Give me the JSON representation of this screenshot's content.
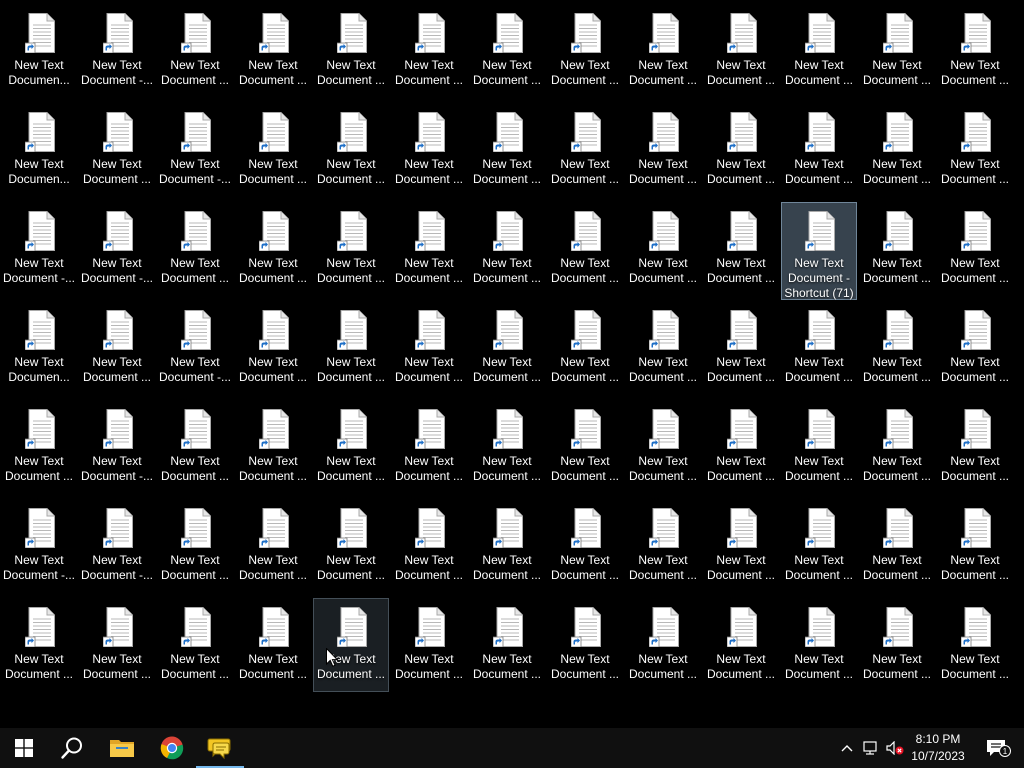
{
  "desktop": {
    "icons": [
      {
        "label1": "New Text",
        "label2": "Documen..."
      },
      {
        "label1": "New Text",
        "label2": "Document -..."
      },
      {
        "label1": "New Text",
        "label2": "Document ..."
      },
      {
        "label1": "New Text",
        "label2": "Document ..."
      },
      {
        "label1": "New Text",
        "label2": "Document ..."
      },
      {
        "label1": "New Text",
        "label2": "Document ..."
      },
      {
        "label1": "New Text",
        "label2": "Document ..."
      },
      {
        "label1": "New Text",
        "label2": "Document ..."
      },
      {
        "label1": "New Text",
        "label2": "Document ..."
      },
      {
        "label1": "New Text",
        "label2": "Document ..."
      },
      {
        "label1": "New Text",
        "label2": "Document ..."
      },
      {
        "label1": "New Text",
        "label2": "Document ..."
      },
      {
        "label1": "New Text",
        "label2": "Document ..."
      },
      {
        "label1": "New Text",
        "label2": "Documen..."
      },
      {
        "label1": "New Text",
        "label2": "Document ..."
      },
      {
        "label1": "New Text",
        "label2": "Document -..."
      },
      {
        "label1": "New Text",
        "label2": "Document ..."
      },
      {
        "label1": "New Text",
        "label2": "Document ..."
      },
      {
        "label1": "New Text",
        "label2": "Document ..."
      },
      {
        "label1": "New Text",
        "label2": "Document ..."
      },
      {
        "label1": "New Text",
        "label2": "Document ..."
      },
      {
        "label1": "New Text",
        "label2": "Document ..."
      },
      {
        "label1": "New Text",
        "label2": "Document ..."
      },
      {
        "label1": "New Text",
        "label2": "Document ..."
      },
      {
        "label1": "New Text",
        "label2": "Document ..."
      },
      {
        "label1": "New Text",
        "label2": "Document ..."
      },
      {
        "label1": "New Text",
        "label2": "Document -..."
      },
      {
        "label1": "New Text",
        "label2": "Document -..."
      },
      {
        "label1": "New Text",
        "label2": "Document ..."
      },
      {
        "label1": "New Text",
        "label2": "Document ..."
      },
      {
        "label1": "New Text",
        "label2": "Document ..."
      },
      {
        "label1": "New Text",
        "label2": "Document ..."
      },
      {
        "label1": "New Text",
        "label2": "Document ..."
      },
      {
        "label1": "New Text",
        "label2": "Document ..."
      },
      {
        "label1": "New Text",
        "label2": "Document ..."
      },
      {
        "label1": "New Text",
        "label2": "Document ..."
      },
      {
        "label1": "New Text",
        "label2": "Document -",
        "label3": "Shortcut (71)",
        "selected": true
      },
      {
        "label1": "New Text",
        "label2": "Document ..."
      },
      {
        "label1": "New Text",
        "label2": "Document ..."
      },
      {
        "label1": "New Text",
        "label2": "Documen..."
      },
      {
        "label1": "New Text",
        "label2": "Document ..."
      },
      {
        "label1": "New Text",
        "label2": "Document -..."
      },
      {
        "label1": "New Text",
        "label2": "Document ..."
      },
      {
        "label1": "New Text",
        "label2": "Document ..."
      },
      {
        "label1": "New Text",
        "label2": "Document ..."
      },
      {
        "label1": "New Text",
        "label2": "Document ..."
      },
      {
        "label1": "New Text",
        "label2": "Document ..."
      },
      {
        "label1": "New Text",
        "label2": "Document ..."
      },
      {
        "label1": "New Text",
        "label2": "Document ..."
      },
      {
        "label1": "New Text",
        "label2": "Document ..."
      },
      {
        "label1": "New Text",
        "label2": "Document ..."
      },
      {
        "label1": "New Text",
        "label2": "Document ..."
      },
      {
        "label1": "New Text",
        "label2": "Document ..."
      },
      {
        "label1": "New Text",
        "label2": "Document -..."
      },
      {
        "label1": "New Text",
        "label2": "Document ..."
      },
      {
        "label1": "New Text",
        "label2": "Document ..."
      },
      {
        "label1": "New Text",
        "label2": "Document ..."
      },
      {
        "label1": "New Text",
        "label2": "Document ..."
      },
      {
        "label1": "New Text",
        "label2": "Document ..."
      },
      {
        "label1": "New Text",
        "label2": "Document ..."
      },
      {
        "label1": "New Text",
        "label2": "Document ..."
      },
      {
        "label1": "New Text",
        "label2": "Document ..."
      },
      {
        "label1": "New Text",
        "label2": "Document ..."
      },
      {
        "label1": "New Text",
        "label2": "Document ..."
      },
      {
        "label1": "New Text",
        "label2": "Document ..."
      },
      {
        "label1": "New Text",
        "label2": "Document -..."
      },
      {
        "label1": "New Text",
        "label2": "Document -..."
      },
      {
        "label1": "New Text",
        "label2": "Document ..."
      },
      {
        "label1": "New Text",
        "label2": "Document ..."
      },
      {
        "label1": "New Text",
        "label2": "Document ..."
      },
      {
        "label1": "New Text",
        "label2": "Document ..."
      },
      {
        "label1": "New Text",
        "label2": "Document ..."
      },
      {
        "label1": "New Text",
        "label2": "Document ..."
      },
      {
        "label1": "New Text",
        "label2": "Document ..."
      },
      {
        "label1": "New Text",
        "label2": "Document ..."
      },
      {
        "label1": "New Text",
        "label2": "Document ..."
      },
      {
        "label1": "New Text",
        "label2": "Document ..."
      },
      {
        "label1": "New Text",
        "label2": "Document ..."
      },
      {
        "label1": "New Text",
        "label2": "Document ..."
      },
      {
        "label1": "New Text",
        "label2": "Document ..."
      },
      {
        "label1": "New Text",
        "label2": "Document ..."
      },
      {
        "label1": "New Text",
        "label2": "Document ..."
      },
      {
        "label1": "New Text",
        "label2": "Document ...",
        "hovered": true
      },
      {
        "label1": "New Text",
        "label2": "Document ..."
      },
      {
        "label1": "New Text",
        "label2": "Document ..."
      },
      {
        "label1": "New Text",
        "label2": "Document ..."
      },
      {
        "label1": "New Text",
        "label2": "Document ..."
      },
      {
        "label1": "New Text",
        "label2": "Document ..."
      },
      {
        "label1": "New Text",
        "label2": "Document ..."
      },
      {
        "label1": "New Text",
        "label2": "Document ..."
      },
      {
        "label1": "New Text",
        "label2": "Document ..."
      }
    ],
    "icon_type": "text-document-shortcut-icon"
  },
  "taskbar": {
    "start_icon": "windows-start-icon",
    "search_icon": "search-icon",
    "pinned": [
      {
        "name": "file-explorer-icon"
      },
      {
        "name": "chrome-icon"
      },
      {
        "name": "chat-app-icon",
        "active": true
      }
    ],
    "tray": {
      "chevron_icon": "chevron-up-icon",
      "network_icon": "network-icon",
      "volume_icon": "volume-muted-icon",
      "time": "8:10 PM",
      "date": "10/7/2023",
      "notification_count": "1"
    },
    "accent_color": "#76b9ed"
  }
}
